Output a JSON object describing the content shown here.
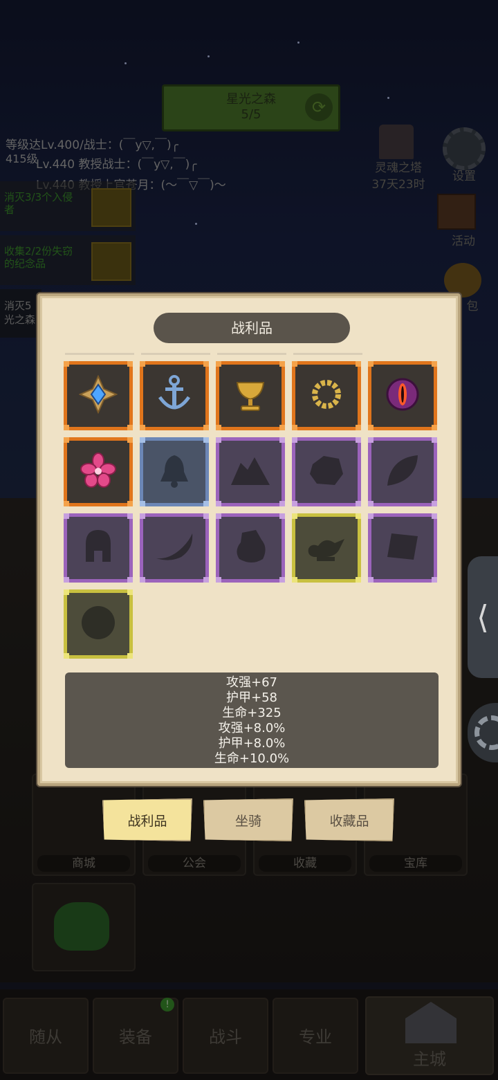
{
  "stage": {
    "name": "星光之森",
    "progress": "5/5"
  },
  "chat": [
    "等级达Lv.400/战士：(￣y▽,￣)╭",
    "Lv.440 教授战士：(￣y▽,￣)╭",
    "Lv.440 教授上官苍月：(～￣▽￣)～"
  ],
  "level_note": "415级",
  "quests": [
    {
      "text": "消灭3/3个入侵者"
    },
    {
      "text": "收集2/2份失窃的纪念品"
    },
    {
      "text": "消灭5光之森"
    }
  ],
  "top_right": {
    "soul_tower": "灵魂之塔",
    "soul_timer": "37天23时",
    "settings": "设置",
    "activity": "活动",
    "bag": "包"
  },
  "panel": {
    "title": "战利品",
    "items": [
      {
        "rarity": "orange",
        "icon": "compass-gem-icon",
        "owned": true
      },
      {
        "rarity": "orange",
        "icon": "anchor-icon",
        "owned": true
      },
      {
        "rarity": "orange",
        "icon": "golden-chalice-icon",
        "owned": true
      },
      {
        "rarity": "orange",
        "icon": "thorn-crown-icon",
        "owned": true
      },
      {
        "rarity": "orange",
        "icon": "demon-eye-icon",
        "owned": true
      },
      {
        "rarity": "orange",
        "icon": "pink-flower-icon",
        "owned": true
      },
      {
        "rarity": "blue",
        "icon": "bell-silhouette-icon",
        "owned": false
      },
      {
        "rarity": "purple",
        "icon": "mountain-silhouette-icon",
        "owned": false
      },
      {
        "rarity": "purple",
        "icon": "rock-silhouette-icon",
        "owned": false
      },
      {
        "rarity": "purple",
        "icon": "leaf-silhouette-icon",
        "owned": false
      },
      {
        "rarity": "purple",
        "icon": "helmet-silhouette-icon",
        "owned": false
      },
      {
        "rarity": "purple",
        "icon": "horn-silhouette-icon",
        "owned": false
      },
      {
        "rarity": "purple",
        "icon": "pouch-silhouette-icon",
        "owned": false
      },
      {
        "rarity": "yellow",
        "icon": "lamp-silhouette-icon",
        "owned": false
      },
      {
        "rarity": "purple",
        "icon": "scroll-silhouette-icon",
        "owned": false
      },
      {
        "rarity": "yellow",
        "icon": "orb-silhouette-icon",
        "owned": false
      }
    ],
    "stats": [
      "攻强+67",
      "护甲+58",
      "生命+325",
      "攻强+8.0%",
      "护甲+8.0%",
      "生命+10.0%"
    ]
  },
  "tabs": [
    {
      "label": "战利品",
      "active": true
    },
    {
      "label": "坐骑",
      "active": false
    },
    {
      "label": "收藏品",
      "active": false
    }
  ],
  "buildings": [
    "商城",
    "公会",
    "收藏",
    "宝库"
  ],
  "nav": {
    "tabs": [
      "随从",
      "装备",
      "战斗",
      "专业"
    ],
    "castle": "主城",
    "badge": "!"
  },
  "colors": {
    "orange": "#e0751c",
    "blue": "#6c87b6",
    "purple": "#9b63bb",
    "yellow": "#c8c040",
    "quest_green": "#3f9a2e"
  }
}
